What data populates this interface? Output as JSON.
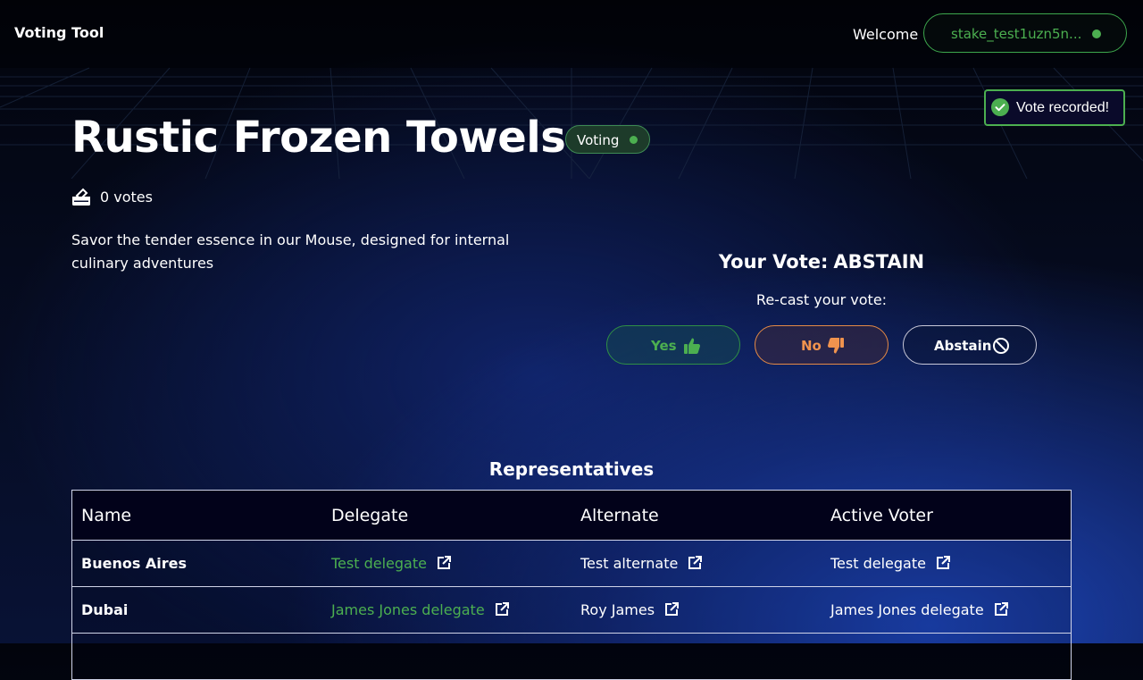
{
  "header": {
    "brand": "Voting Tool",
    "welcome": "Welcome",
    "wallet_address": "stake_test1uzn5n..."
  },
  "toast": {
    "message": "Vote recorded!"
  },
  "proposal": {
    "title": "Rustic Frozen Towels",
    "status": "Voting",
    "votes": "0 votes",
    "description": "Savor the tender essence in our Mouse, designed for internal culinary adventures"
  },
  "vote": {
    "your_vote_label": "Your Vote:",
    "your_vote_value": "ABSTAIN",
    "recast_label": "Re-cast your vote:",
    "yes_label": "Yes",
    "no_label": "No",
    "abstain_label": "Abstain"
  },
  "representatives": {
    "title": "Representatives",
    "columns": [
      "Name",
      "Delegate",
      "Alternate",
      "Active Voter"
    ],
    "rows": [
      {
        "name": "Buenos Aires",
        "delegate": "Test delegate",
        "alternate": "Test alternate",
        "active_voter": "Test delegate"
      },
      {
        "name": "Dubai",
        "delegate": "James Jones delegate",
        "alternate": "Roy James",
        "active_voter": "James Jones delegate"
      }
    ]
  },
  "colors": {
    "accent_green": "#4caf50",
    "no_orange": "#f0934e",
    "toast_bg": "#0a0a2a"
  },
  "icons": {
    "wallet_status": "status-dot",
    "toast": "check-circle-icon",
    "votes": "ballot-box-icon",
    "yes": "thumbs-up-icon",
    "no": "thumbs-down-icon",
    "abstain": "prohibited-icon",
    "links": "external-link-icon"
  }
}
